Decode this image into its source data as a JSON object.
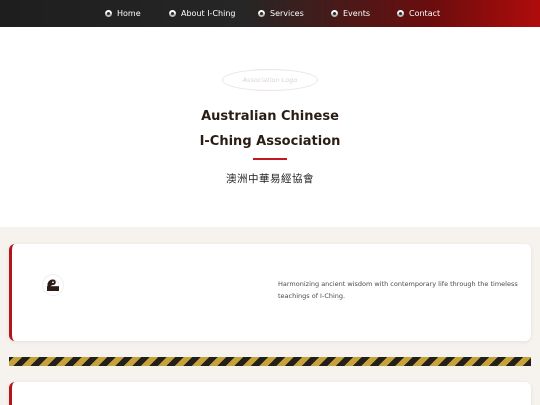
{
  "nav": {
    "items": [
      {
        "label": "Home"
      },
      {
        "label": "About I-Ching"
      },
      {
        "label": "Services"
      },
      {
        "label": "Events"
      },
      {
        "label": "Contact"
      }
    ]
  },
  "hero": {
    "logo_placeholder": "Association Logo",
    "title_line1": "Australian Chinese",
    "title_line2": "I-Ching Association",
    "chinese_title": "澳洲中華易經協會"
  },
  "intro_card": {
    "text": "Harmonizing ancient wisdom with contemporary life through the timeless teachings of I-Ching."
  },
  "colors": {
    "accent": "#c4181f",
    "nav_start": "#1e1e1e",
    "nav_end": "#b00c0c",
    "stripe_dark": "#231f1a",
    "stripe_gold": "#c6a33a"
  }
}
